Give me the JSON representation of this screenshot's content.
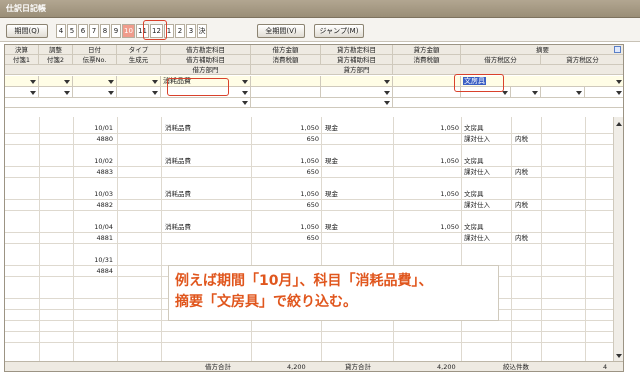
{
  "window": {
    "title": "仕訳日記帳"
  },
  "toolbar": {
    "period_button": "期間(Q)",
    "months": [
      "4",
      "5",
      "6",
      "7",
      "8",
      "9",
      "10",
      "11",
      "12",
      "1",
      "2",
      "3",
      "決"
    ],
    "all_period_button": "全期間(V)",
    "jump_button": "ジャンプ(M)"
  },
  "headers": {
    "row1": [
      "決算",
      "調整",
      "日付",
      "タイプ",
      "借方勘定科目",
      "借方金額",
      "貸方勘定科目",
      "貸方金額",
      "摘要"
    ],
    "row2": [
      "付箋1",
      "付箋2",
      "伝票No.",
      "生成元",
      "借方補助科目",
      "消費税額",
      "貸方補助科目",
      "消費税額",
      "借方税区分",
      "貸方税区分"
    ],
    "row3": [
      "借方部門",
      "貸方部門"
    ]
  },
  "filter": {
    "debit_account": "消耗品費",
    "summary": "文房具"
  },
  "entries": [
    {
      "date": "10/01",
      "no": "4880",
      "debit": "消耗品費",
      "amount": "1,050",
      "tax": "650",
      "credit": "現金",
      "camount": "1,050",
      "memo": "文房具",
      "taxcat": "課対仕入",
      "taxtype": "内税"
    },
    {
      "date": "10/02",
      "no": "4883",
      "debit": "消耗品費",
      "amount": "1,050",
      "tax": "650",
      "credit": "現金",
      "camount": "1,050",
      "memo": "文房具",
      "taxcat": "課対仕入",
      "taxtype": "内税"
    },
    {
      "date": "10/03",
      "no": "4882",
      "debit": "消耗品費",
      "amount": "1,050",
      "tax": "650",
      "credit": "現金",
      "camount": "1,050",
      "memo": "文房具",
      "taxcat": "課対仕入",
      "taxtype": "内税"
    },
    {
      "date": "10/04",
      "no": "4881",
      "debit": "消耗品費",
      "amount": "1,050",
      "tax": "650",
      "credit": "現金",
      "camount": "1,050",
      "memo": "文房具",
      "taxcat": "課対仕入",
      "taxtype": "内税"
    },
    {
      "date": "10/31",
      "no": "4884",
      "debit": "",
      "amount": "",
      "tax": "",
      "credit": "",
      "camount": "",
      "memo": "",
      "taxcat": "",
      "taxtype": ""
    }
  ],
  "footer": {
    "debit_total_label": "借方合計",
    "debit_total": "4,200",
    "credit_total_label": "貸方合計",
    "credit_total": "4,200",
    "count_label": "絞込件数",
    "count": "4"
  },
  "callout": {
    "line1": "例えば期間「10月」、科目「消耗品費」、",
    "line2": "摘要「文房具」で絞り込む。"
  }
}
